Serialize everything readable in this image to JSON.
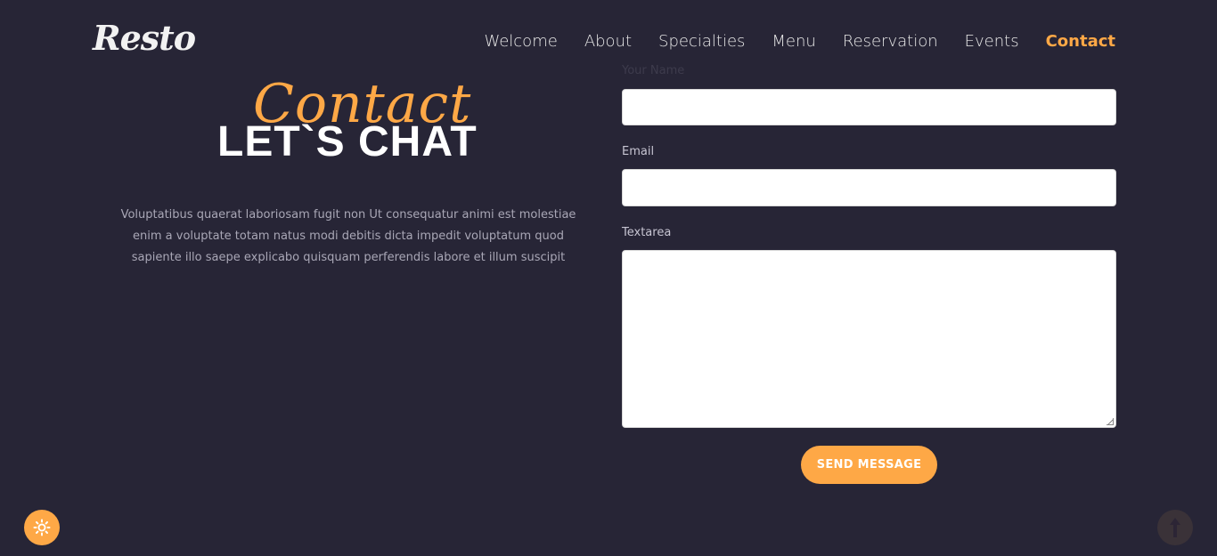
{
  "header": {
    "logo": "Resto",
    "nav": [
      {
        "label": "Welcome"
      },
      {
        "label": "About"
      },
      {
        "label": "Specialties"
      },
      {
        "label": "Menu"
      },
      {
        "label": "Reservation"
      },
      {
        "label": "Events"
      },
      {
        "label": "Contact",
        "active": true
      }
    ]
  },
  "hero": {
    "script_title": "Contact",
    "title": "LET`S CHAT",
    "description": "Voluptatibus quaerat laboriosam fugit non Ut consequatur animi est molestiae enim a voluptate totam natus modi debitis dicta impedit voluptatum quod sapiente illo saepe explicabo quisquam perferendis labore et illum suscipit"
  },
  "form": {
    "name_label": "Your Name",
    "name_value": "",
    "email_label": "Email",
    "email_value": "",
    "textarea_label": "Textarea",
    "textarea_value": "",
    "submit_label": "SEND MESSAGE"
  },
  "floating": {
    "theme_icon": "sun-icon",
    "scroll_icon": "arrow-up-icon"
  },
  "colors": {
    "background": "#272536",
    "accent": "#fea846",
    "text_light": "#e8e8e8"
  }
}
